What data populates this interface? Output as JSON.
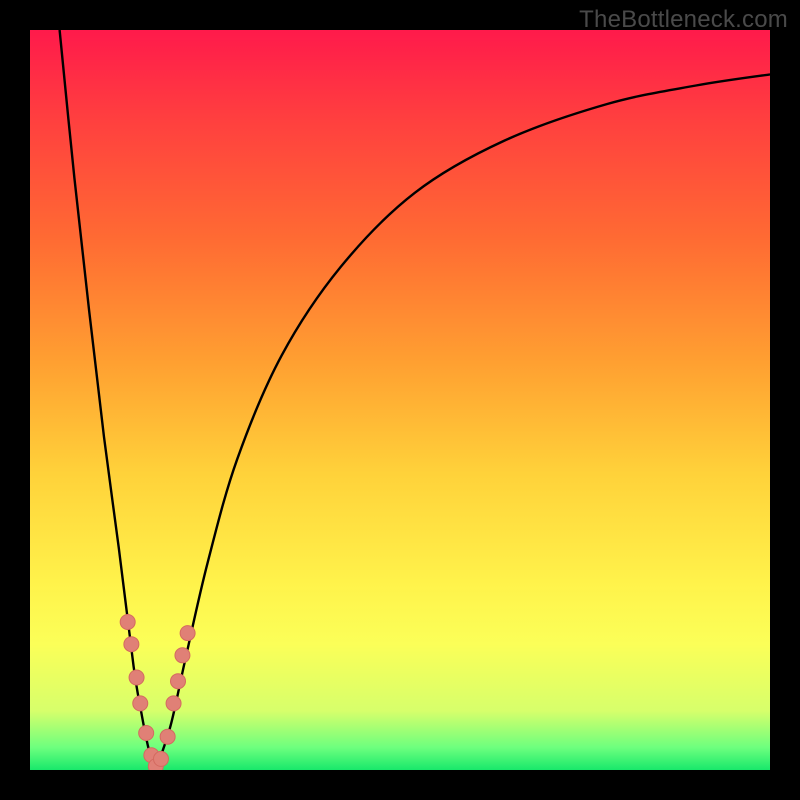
{
  "watermark": "TheBottleneck.com",
  "colors": {
    "frame": "#000000",
    "curve": "#000000",
    "marker_fill": "#e08076",
    "marker_stroke": "#d46a60"
  },
  "chart_data": {
    "type": "line",
    "title": "",
    "xlabel": "",
    "ylabel": "",
    "xlim": [
      0,
      100
    ],
    "ylim": [
      0,
      100
    ],
    "grid": false,
    "legend": false,
    "note": "Bottleneck-style V-curve. x is a normalized component axis (0–100), y is bottleneck percentage (0 = none, 100 = maximum). Values estimated from pixels; no numeric tick labels are shown in the source image.",
    "optimum_x": 17,
    "series": [
      {
        "name": "left-branch",
        "x": [
          4,
          6,
          8,
          10,
          12,
          14,
          15,
          16,
          17
        ],
        "y": [
          100,
          80,
          62,
          45,
          30,
          14,
          8,
          3,
          0
        ]
      },
      {
        "name": "right-branch",
        "x": [
          17,
          19,
          21,
          24,
          28,
          34,
          42,
          52,
          64,
          78,
          90,
          100
        ],
        "y": [
          0,
          6,
          15,
          28,
          42,
          56,
          68,
          78,
          85,
          90,
          92.5,
          94
        ]
      }
    ],
    "markers": {
      "name": "sample-points",
      "x": [
        13.2,
        13.7,
        14.4,
        14.9,
        15.7,
        16.4,
        17.0,
        17.7,
        18.6,
        19.4,
        20.0,
        20.6,
        21.3
      ],
      "y": [
        20.0,
        17.0,
        12.5,
        9.0,
        5.0,
        2.0,
        0.5,
        1.5,
        4.5,
        9.0,
        12.0,
        15.5,
        18.5
      ]
    }
  }
}
